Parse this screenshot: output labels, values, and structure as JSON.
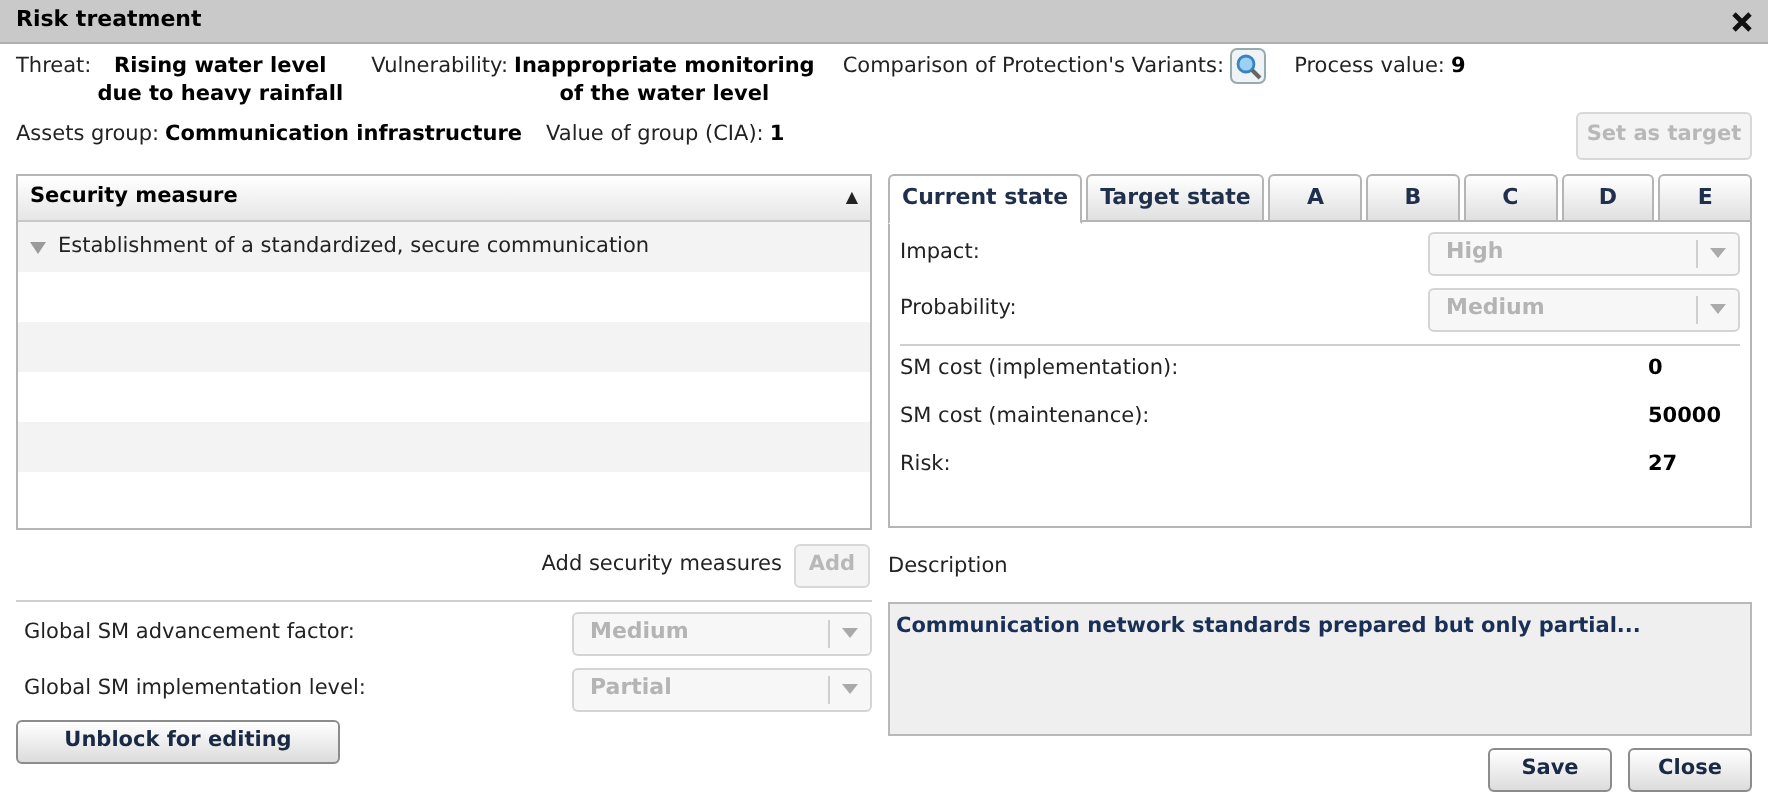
{
  "window": {
    "title": "Risk treatment"
  },
  "threat": {
    "label": "Threat:",
    "value_lines": [
      "Rising water level",
      "due to heavy rainfall"
    ]
  },
  "vulnerability": {
    "label": "Vulnerability:",
    "value_lines": [
      "Inappropriate monitoring",
      "of the water level"
    ]
  },
  "comparison": {
    "label": "Comparison of Protection's Variants:"
  },
  "process_value": {
    "label": "Process value:",
    "value": "9"
  },
  "assets_group": {
    "label": "Assets group:",
    "value": "Communication infrastructure"
  },
  "group_value": {
    "label": "Value of group (CIA):",
    "value": "1"
  },
  "set_as_target": {
    "label": "Set as target",
    "disabled": true
  },
  "measures_table": {
    "column": "Security measure",
    "sort_icon": "▲",
    "rows": [
      {
        "text": "Establishment of a standardized, secure communication",
        "expanded": true
      }
    ]
  },
  "tabs": [
    {
      "label": "Current state",
      "selected": true
    },
    {
      "label": "Target state",
      "selected": false
    },
    {
      "label": "A",
      "selected": false
    },
    {
      "label": "B",
      "selected": false
    },
    {
      "label": "C",
      "selected": false
    },
    {
      "label": "D",
      "selected": false
    },
    {
      "label": "E",
      "selected": false
    }
  ],
  "state_fields": [
    {
      "label": "Impact:",
      "value": "High",
      "disabled": true
    },
    {
      "label": "Probability:",
      "value": "Medium",
      "disabled": true
    }
  ],
  "costs": [
    {
      "label": "SM cost (implementation):",
      "value": "0"
    },
    {
      "label": "SM cost (maintenance):",
      "value": "50000"
    },
    {
      "label": "Risk:",
      "value": "27"
    }
  ],
  "add_measures": {
    "label": "Add security measures",
    "button": "Add",
    "disabled": true
  },
  "global_fields": [
    {
      "label": "Global SM advancement factor:",
      "value": "Medium",
      "disabled": true
    },
    {
      "label": "Global SM implementation level:",
      "value": "Partial",
      "disabled": true
    }
  ],
  "description": {
    "label": "Description",
    "value": "Communication network standards prepared but only partial..."
  },
  "buttons": {
    "unblock": "Unblock for editing",
    "save": "Save",
    "close": "Close"
  }
}
